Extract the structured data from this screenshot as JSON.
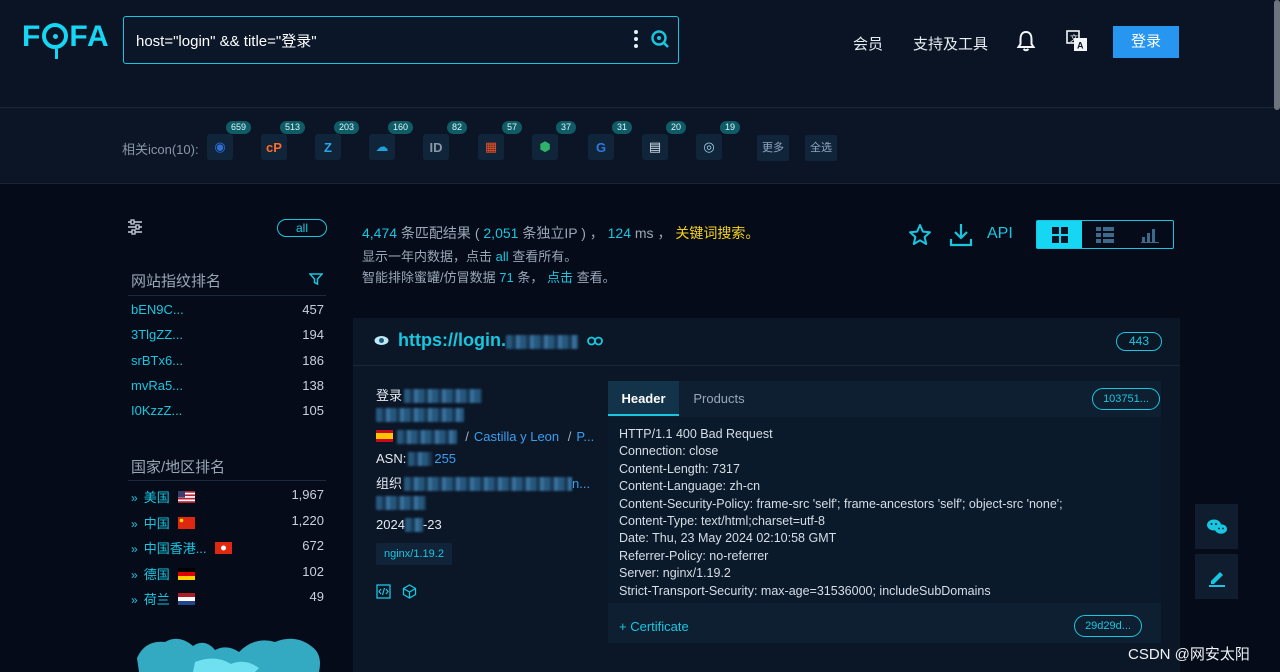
{
  "header": {
    "logo": "FOFA",
    "search_query": "host=\"login\" && title=\"登录\"",
    "nav": {
      "vip": "会员",
      "tools": "支持及工具"
    },
    "login_label": "登录"
  },
  "icon_row": {
    "label": "相关icon(10):",
    "icons": [
      {
        "name": "circle-logo-icon",
        "count": "659",
        "color": "#2d6ed8",
        "glyph": "◉"
      },
      {
        "name": "cpanel-icon",
        "count": "513",
        "color": "#ff6c2c",
        "glyph": "cP"
      },
      {
        "name": "zimbra-icon",
        "count": "203",
        "color": "#2aa4e6",
        "glyph": "Z"
      },
      {
        "name": "salesforce-icon",
        "count": "160",
        "color": "#1ea2dc",
        "glyph": "☁"
      },
      {
        "name": "id-shield-icon",
        "count": "82",
        "color": "#8a97a8",
        "glyph": "ID"
      },
      {
        "name": "microsoft-icon",
        "count": "57",
        "color": "#f25022",
        "glyph": "▦"
      },
      {
        "name": "hex-cube-icon",
        "count": "37",
        "color": "#2fb36b",
        "glyph": "⬢"
      },
      {
        "name": "g-suite-icon",
        "count": "31",
        "color": "#2f78e0",
        "glyph": "G"
      },
      {
        "name": "document-icon",
        "count": "20",
        "color": "#d9e2ec",
        "glyph": "▤"
      },
      {
        "name": "eye-logo-icon",
        "count": "19",
        "color": "#9fd4ea",
        "glyph": "◎"
      }
    ],
    "more": "更多",
    "select_all": "全选"
  },
  "sidebar": {
    "all_label": "all",
    "fingerprint_title": "网站指纹排名",
    "fingerprints": [
      {
        "name": "bEN9C...",
        "count": "457"
      },
      {
        "name": "3TlgZZ...",
        "count": "194"
      },
      {
        "name": "srBTx6...",
        "count": "186"
      },
      {
        "name": "mvRa5...",
        "count": "138"
      },
      {
        "name": "I0KzzZ...",
        "count": "105"
      }
    ],
    "country_title": "国家/地区排名",
    "countries": [
      {
        "name": "美国",
        "count": "1,967",
        "flag": "us"
      },
      {
        "name": "中国",
        "count": "1,220",
        "flag": "cn"
      },
      {
        "name": "中国香港...",
        "count": "672",
        "flag": "hk"
      },
      {
        "name": "德国",
        "count": "102",
        "flag": "de"
      },
      {
        "name": "荷兰",
        "count": "49",
        "flag": "nl"
      }
    ]
  },
  "summary": {
    "total": "4,474",
    "total_suffix": " 条匹配结果 ( ",
    "unique_ip": "2,051",
    "unique_suffix": " 条独立IP ) ， ",
    "time": "124",
    "time_suffix": " ms ， ",
    "keyword_search": "关键词搜索。",
    "line2_a": "显示一年内数据，点击 ",
    "line2_all": "all",
    "line2_b": " 查看所有。",
    "line3_a": "智能排除蜜罐/仿冒数据 ",
    "line3_count": "71",
    "line3_b": " 条， ",
    "line3_click": "点击",
    "line3_c": " 查看。",
    "api_label": "API"
  },
  "result": {
    "url": "https://login.",
    "port": "443",
    "title": "登录",
    "location_sep1": "/",
    "region": "Castilla y Leon",
    "location_sep2": "/",
    "city": "P...",
    "asn_label": "ASN:",
    "asn_value": "255",
    "org_label": "组织",
    "org_value": "n...",
    "date": "2024",
    "date_suffix": "-23",
    "server_tag": "nginx/1.19.2",
    "tabs": {
      "header": "Header",
      "products": "Products"
    },
    "header_hash": "103751...",
    "header_lines": [
      "HTTP/1.1 400 Bad Request",
      "Connection: close",
      "Content-Length: 7317",
      "Content-Language: zh-cn",
      "Content-Security-Policy: frame-src 'self'; frame-ancestors 'self'; object-src 'none';",
      "Content-Type: text/html;charset=utf-8",
      "Date: Thu, 23 May 2024 02:10:58 GMT",
      "Referrer-Policy: no-referrer",
      "Server: nginx/1.19.2",
      "Strict-Transport-Security: max-age=31536000; includeSubDomains"
    ],
    "cert_label": "+ Certificate",
    "cert_hash": "29d29d..."
  },
  "watermark": "CSDN @网安太阳",
  "colors": {
    "accent": "#18c6e0",
    "highlight": "#f5d11a",
    "primary_button": "#2696f0"
  }
}
